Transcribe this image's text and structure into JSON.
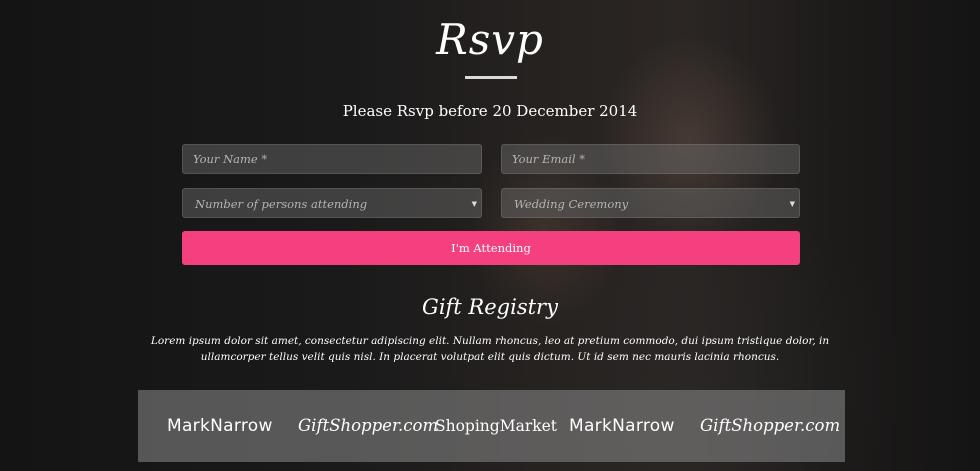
{
  "rsvp": {
    "title": "Rsvp",
    "subtitle": "Please Rsvp before 20 December 2014"
  },
  "form": {
    "name_placeholder": "Your Name *",
    "email_placeholder": "Your Email *",
    "persons_select": {
      "selected": "Number of persons attending"
    },
    "event_select": {
      "selected": "Wedding Ceremony"
    },
    "submit_label": "I'm Attending",
    "accent_color": "#f4407f"
  },
  "gift_registry": {
    "title": "Gift Registry",
    "text": "Lorem ipsum dolor sit amet, consectetur adipiscing elit. Nullam rhoncus, leo at pretium commodo, dui ipsum tristique dolor, in ullamcorper tellus velit quis nisl. In placerat volutpat elit quis dictum. Ut id sem nec mauris lacinia rhoncus.",
    "logos": [
      "MarkNarrow",
      "GiftShopper.com",
      "ShopingMarket",
      "MarkNarrow",
      "GiftShopper.com"
    ]
  }
}
